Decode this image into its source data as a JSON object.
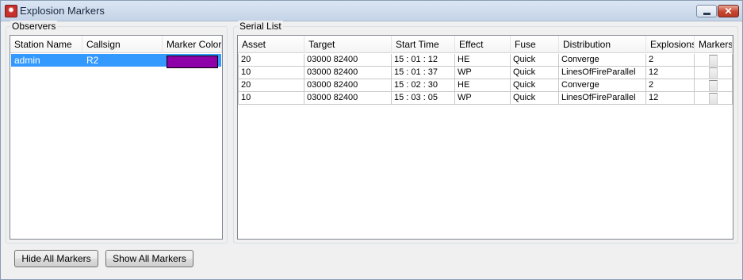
{
  "window": {
    "title": "Explosion Markers"
  },
  "observers": {
    "group_label": "Observers",
    "columns": [
      "Station Name",
      "Callsign",
      "Marker Color"
    ],
    "rows": [
      {
        "station": "admin",
        "callsign": "R2",
        "marker_color": "#8e00a8"
      }
    ]
  },
  "serial_list": {
    "group_label": "Serial List",
    "columns": [
      "Asset",
      "Target",
      "Start Time",
      "Effect",
      "Fuse",
      "Distribution",
      "Explosions",
      "Markers"
    ],
    "rows": [
      {
        "asset": "20",
        "target": "03000 82400",
        "start_time": "15 : 01 : 12",
        "effect": "HE",
        "fuse": "Quick",
        "distribution": "Converge",
        "explosions": "2",
        "markers": false
      },
      {
        "asset": "10",
        "target": "03000 82400",
        "start_time": "15 : 01 : 37",
        "effect": "WP",
        "fuse": "Quick",
        "distribution": "LinesOfFireParallel",
        "explosions": "12",
        "markers": false
      },
      {
        "asset": "20",
        "target": "03000 82400",
        "start_time": "15 : 02 : 30",
        "effect": "HE",
        "fuse": "Quick",
        "distribution": "Converge",
        "explosions": "2",
        "markers": false
      },
      {
        "asset": "10",
        "target": "03000 82400",
        "start_time": "15 : 03 : 05",
        "effect": "WP",
        "fuse": "Quick",
        "distribution": "LinesOfFireParallel",
        "explosions": "12",
        "markers": false
      }
    ]
  },
  "buttons": {
    "hide_all": "Hide All Markers",
    "show_all": "Show All Markers"
  },
  "colors": {
    "selection": "#3399ff",
    "titlebar": "#c4d3e7",
    "close_button": "#c8452f"
  }
}
